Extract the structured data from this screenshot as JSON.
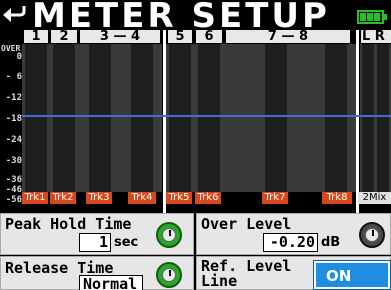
{
  "title": "METER SETUP",
  "meters": {
    "scale_over": "OVER",
    "scale": [
      "0",
      "- 6",
      "-12",
      "-18",
      "-24",
      "-30",
      "-36",
      "-46",
      "-56"
    ],
    "channels": [
      {
        "label": "1",
        "track": "Trk1"
      },
      {
        "label": "2",
        "track": "Trk2"
      },
      {
        "label": "3 — 4",
        "track": "Trk3",
        "track2": "Trk4"
      },
      {
        "label": "5",
        "track": "Trk5"
      },
      {
        "label": "6",
        "track": "Trk6"
      },
      {
        "label": "7 — 8",
        "track": "Trk7",
        "track2": "Trk8"
      },
      {
        "label": "L R",
        "track": "2Mix"
      }
    ]
  },
  "peak_hold": {
    "label": "Peak Hold Time",
    "value": "1",
    "unit": "sec"
  },
  "over_level": {
    "label": "Over Level",
    "value": "-0.20",
    "unit": "dB"
  },
  "release_time": {
    "label": "Release Time",
    "value": "Normal"
  },
  "ref_level_line": {
    "label_line1": "Ref. Level",
    "label_line2": "Line",
    "value": "ON"
  },
  "colors": {
    "accent": "#1f8ee0",
    "knob": "#2aa62a",
    "track_bg": "#d8481c",
    "ref_line": "#3f6ed8"
  },
  "icons": {
    "back": "back-arrow-icon",
    "battery": "battery-icon"
  }
}
